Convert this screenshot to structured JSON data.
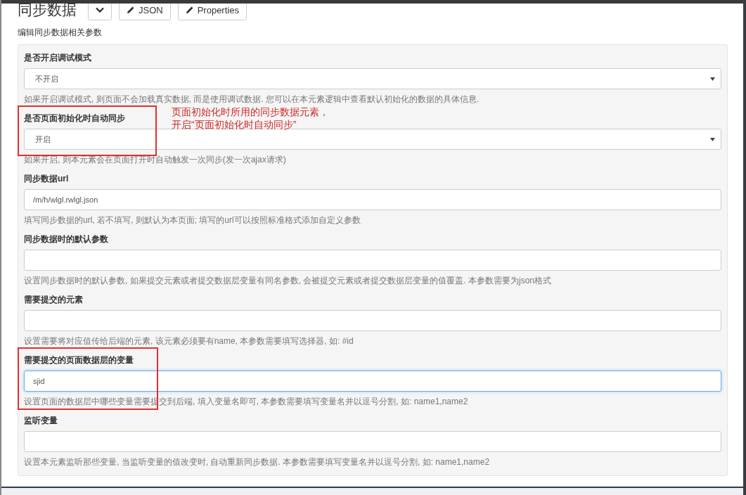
{
  "header": {
    "title": "同步数据",
    "buttons": [
      {
        "kind": "caret"
      },
      {
        "kind": "edit",
        "label": "JSON"
      },
      {
        "kind": "edit",
        "label": "Properties"
      }
    ]
  },
  "subtitle": "编辑同步数据相关参数",
  "fields": [
    {
      "kind": "select",
      "label": "是否开启调试模式",
      "value": "不开启",
      "help": "如果开启调试模式, 则页面不会加载真实数据, 而是使用调试数据. 您可以在本元素逻辑中查看默认初始化的数据的具体信息.",
      "focused": false,
      "highlighted": false
    },
    {
      "kind": "select",
      "label": "是否页面初始化时自动同步",
      "value": "开启",
      "help": "如果开启, 则本元素会在页面打开时自动触发一次同步(发一次ajax请求)",
      "focused": false,
      "highlighted": true,
      "note": [
        "页面初始化时所用的同步数据元素，",
        "开启“页面初始化时自动同步”"
      ]
    },
    {
      "kind": "input",
      "label": "同步数据url",
      "value": "/m/h/wlgl.rwlgl.json",
      "help": "填写同步数据的url, 若不填写, 则默认为本页面; 填写的url可以按照标准格式添加自定义参数",
      "focused": false,
      "highlighted": false
    },
    {
      "kind": "input",
      "label": "同步数据时的默认参数",
      "help": "设置同步数据时的默认参数, 如果提交元素或者提交数据层变量有同名参数, 会被提交元素或者提交数据层变量的值覆盖. 本参数需要为json格式",
      "focused": false,
      "highlighted": false
    },
    {
      "kind": "input",
      "label": "需要提交的元素",
      "help": "设置需要将对应值传给后端的元素, 该元素必须要有name, 本参数需要填写选择器, 如: #id",
      "focused": false,
      "highlighted": false
    },
    {
      "kind": "input",
      "label": "需要提交的页面数据层的变量",
      "value": "sjid",
      "help": "设置页面的数据层中哪些变量需要提交到后端, 填入变量名即可, 本参数需要填写变量名并以逗号分割, 如: name1,name2",
      "focused": true,
      "highlighted": true
    },
    {
      "kind": "input",
      "label": "监听变量",
      "help": "设置本元素监听那些变量, 当监听变量的值改变时, 自动重新同步数据. 本参数需要填写变量名并以逗号分割, 如: name1,name2",
      "focused": false,
      "highlighted": false
    }
  ]
}
